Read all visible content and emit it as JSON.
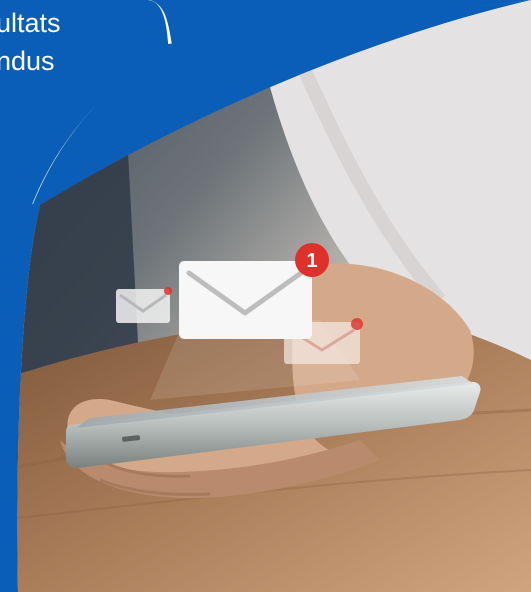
{
  "headline": {
    "line1": "ultats",
    "line2": "ndus"
  },
  "notifications": {
    "main_badge": "1"
  },
  "colors": {
    "brand_blue": "#0a5eb8",
    "badge_red": "#e0302a",
    "wood": "#a97c58",
    "shirt": "#e4e2e2"
  },
  "icons": [
    "envelope-icon",
    "envelope-icon",
    "envelope-icon",
    "notification-badge"
  ]
}
